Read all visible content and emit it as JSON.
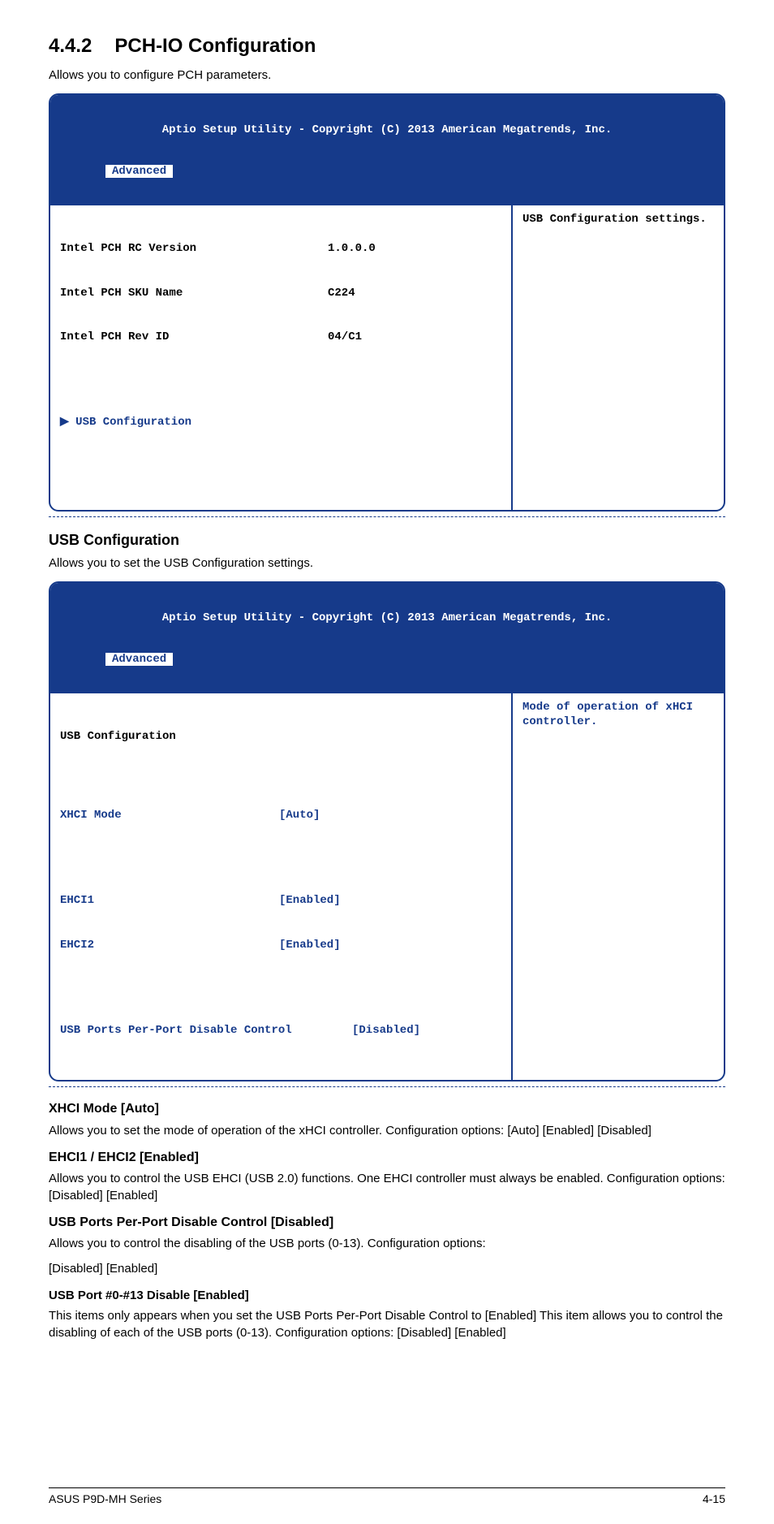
{
  "section": {
    "number": "4.4.2",
    "title": "PCH-IO Configuration",
    "intro": "Allows you to configure PCH parameters."
  },
  "bios1": {
    "header_title": "Aptio Setup Utility - Copyright (C) 2013 American Megatrends, Inc.",
    "tab": "Advanced",
    "rows": {
      "r1_label": "Intel PCH RC Version",
      "r1_val": "1.0.0.0",
      "r2_label": "Intel PCH SKU Name",
      "r2_val": "C224",
      "r3_label": "Intel PCH Rev ID",
      "r3_val": "04/C1"
    },
    "usb_config": "USB Configuration",
    "help": "USB Configuration settings."
  },
  "usb_section": {
    "heading": "USB Configuration",
    "desc": "Allows you to set the USB Configuration settings."
  },
  "bios2": {
    "header_title": "Aptio Setup Utility - Copyright (C) 2013 American Megatrends, Inc.",
    "tab": "Advanced",
    "title_row": "USB Configuration",
    "rows": {
      "xhci_label": "XHCI Mode",
      "xhci_val": "[Auto]",
      "ehci1_label": "EHCI1",
      "ehci1_val": "[Enabled]",
      "ehci2_label": "EHCI2",
      "ehci2_val": "[Enabled]",
      "perport_label": "USB Ports Per-Port Disable Control",
      "perport_val": "[Disabled]"
    },
    "help": "Mode of operation of xHCI controller."
  },
  "xhci": {
    "heading": "XHCI Mode [Auto]",
    "desc": "Allows you to set the mode of operation of the xHCI controller. Configuration options: [Auto] [Enabled] [Disabled]"
  },
  "ehci": {
    "heading": "EHCI1 / EHCI2 [Enabled]",
    "desc": "Allows you to control the USB EHCI (USB 2.0) functions. One EHCI controller must always be enabled. Configuration options: [Disabled] [Enabled]"
  },
  "perport": {
    "heading": "USB Ports Per-Port Disable Control [Disabled]",
    "desc1": "Allows you to control the disabling of the USB ports (0-13). Configuration options:",
    "desc2": "[Disabled] [Enabled]"
  },
  "port013": {
    "heading": "USB Port #0-#13 Disable [Enabled]",
    "desc": "This items only appears when you set the USB Ports Per-Port Disable Control to [Enabled] This item allows you to control the disabling of each of the USB ports (0-13). Configuration options: [Disabled] [Enabled]"
  },
  "footer": {
    "left": "ASUS P9D-MH Series",
    "right": "4-15"
  }
}
